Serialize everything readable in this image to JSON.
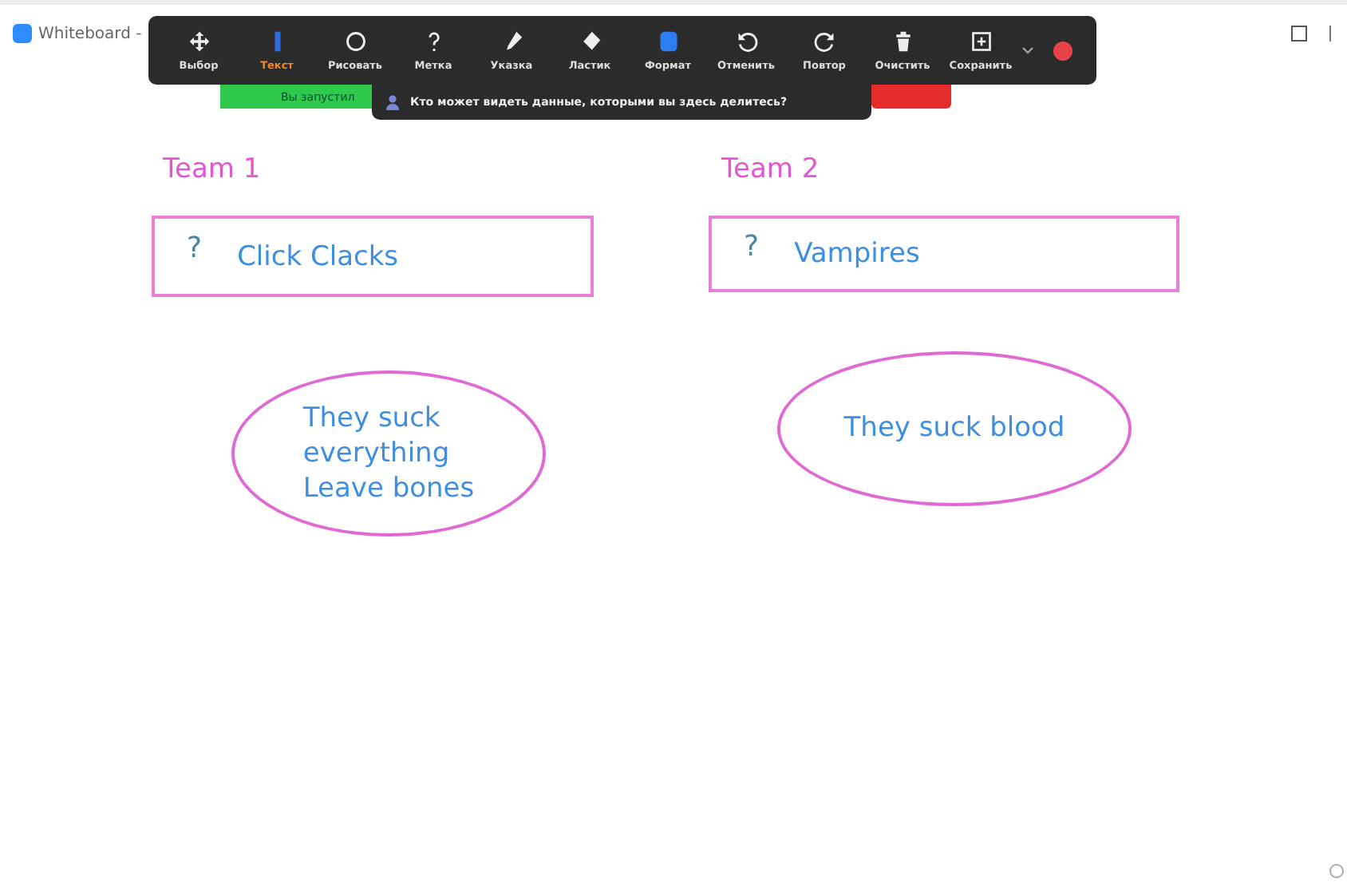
{
  "window": {
    "title": "Whiteboard -"
  },
  "toolbar": {
    "tools": [
      {
        "label": "Выбор",
        "kind": "move",
        "selected": false
      },
      {
        "label": "Текст",
        "kind": "text",
        "selected": true
      },
      {
        "label": "Рисовать",
        "kind": "circle",
        "selected": false
      },
      {
        "label": "Метка",
        "kind": "question",
        "selected": false
      },
      {
        "label": "Указка",
        "kind": "pen",
        "selected": false
      },
      {
        "label": "Ластик",
        "kind": "eraser",
        "selected": false
      },
      {
        "label": "Формат",
        "kind": "square",
        "selected": false
      },
      {
        "label": "Отменить",
        "kind": "undo",
        "selected": false
      },
      {
        "label": "Повтор",
        "kind": "redo",
        "selected": false
      },
      {
        "label": "Очистить",
        "kind": "trash",
        "selected": false
      },
      {
        "label": "Сохранить",
        "kind": "save",
        "selected": false
      }
    ]
  },
  "notification": {
    "text": "Вы запустил"
  },
  "tooltip": {
    "text": "Кто может видеть данные, которыми вы здесь делитесь?"
  },
  "teams": [
    {
      "heading": "Team 1",
      "mark": "?",
      "name": "Click Clacks",
      "note": "They suck\neverything\nLeave bones"
    },
    {
      "heading": "Team 2",
      "mark": "?",
      "name": "Vampires",
      "note": "They suck blood"
    }
  ]
}
